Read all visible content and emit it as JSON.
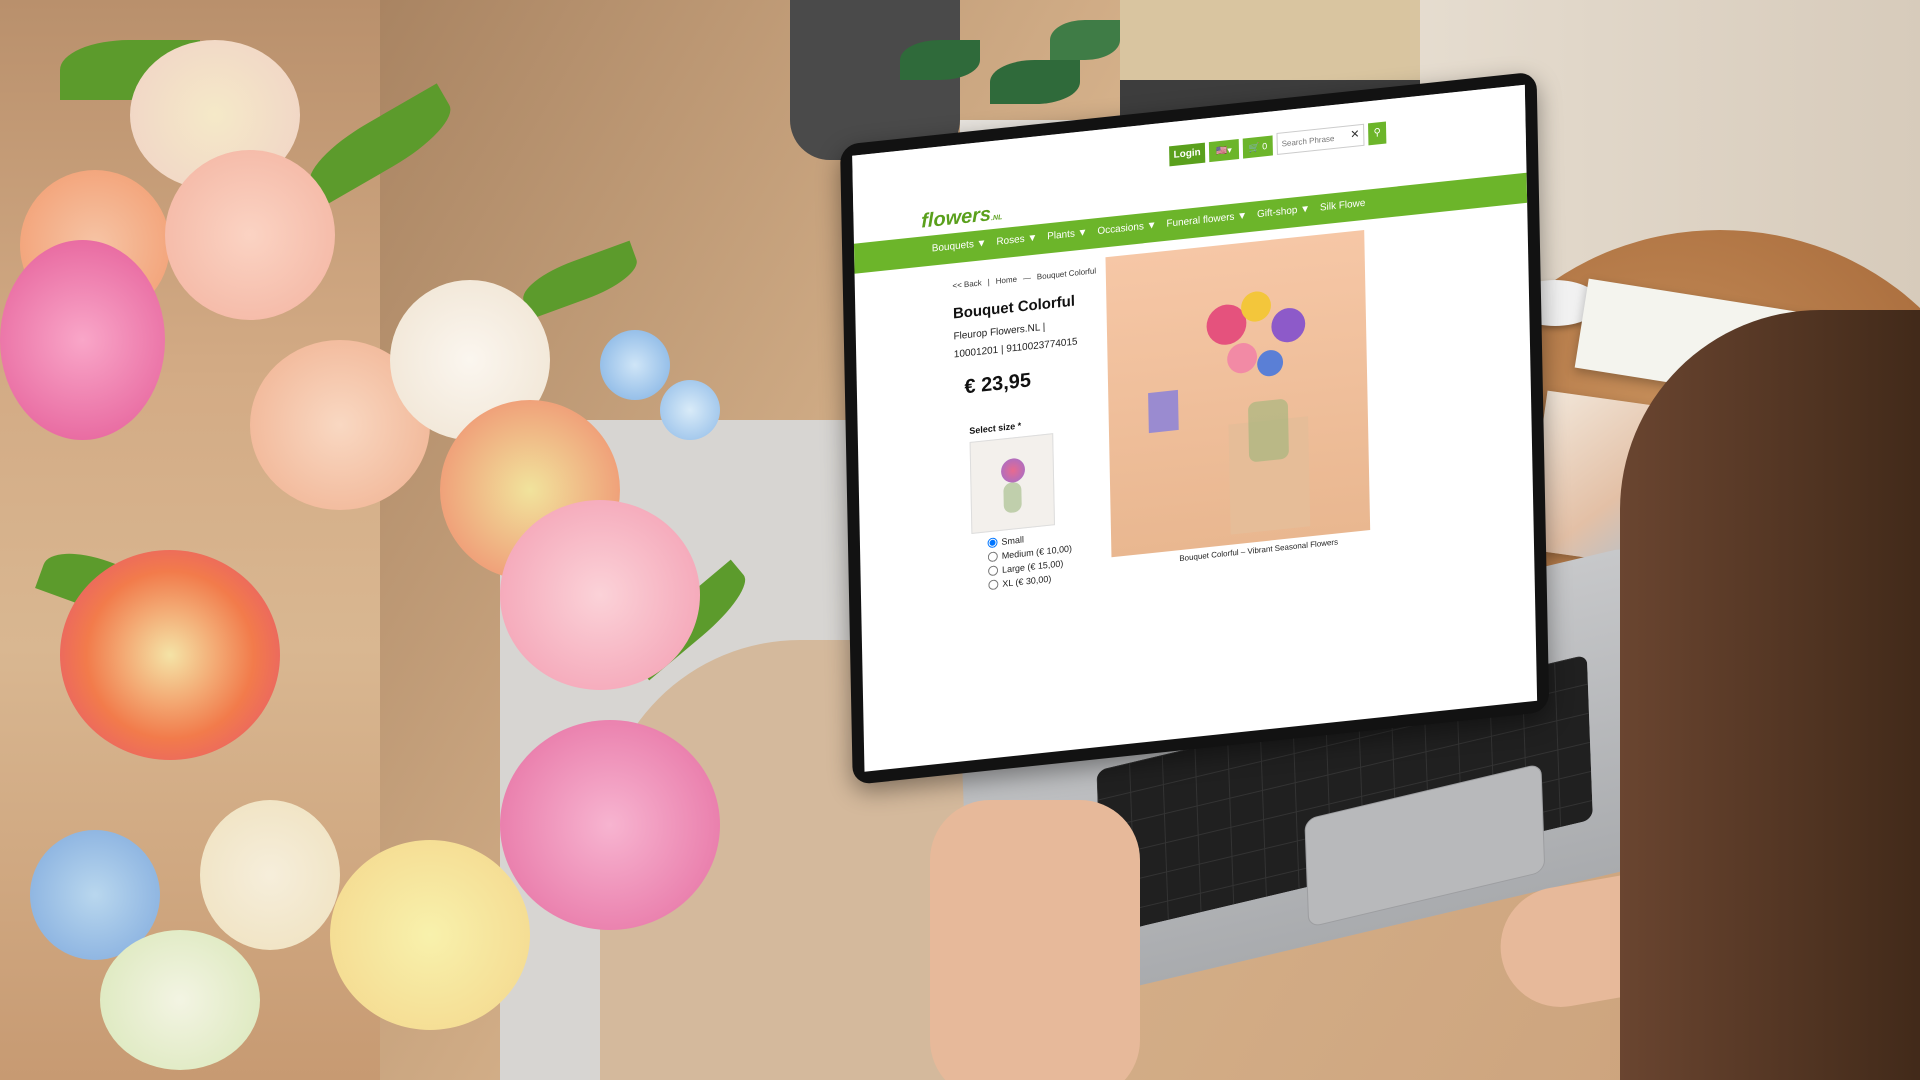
{
  "site": {
    "logo": "flowers",
    "logo_suffix": ".NL",
    "login_label": "Login",
    "cart_count": "0",
    "search_placeholder": "Search Phrase",
    "clear_icon": "✕",
    "search_icon": "⚲",
    "nav_items": [
      "Bouquets ▼",
      "Roses ▼",
      "Plants ▼",
      "Occasions ▼",
      "Funeral flowers ▼",
      "Gift-shop ▼",
      "Silk Flowe"
    ],
    "breadcrumb": [
      "<< Back",
      "|",
      "Home",
      "—",
      "Bouquet Colorful"
    ]
  },
  "product": {
    "title": "Bouquet Colorful",
    "brand": "Fleurop Flowers.NL  |",
    "codes": "10001201  |  9110023774015",
    "price": "€ 23,95",
    "select_size_label": "Select size *",
    "options": [
      "Small",
      "Medium (€ 10,00)",
      "Large (€ 15,00)",
      "XL (€ 30,00)"
    ],
    "selected_option": "Small",
    "caption": "Bouquet Colorful – Vibrant Seasonal Flowers"
  },
  "colors": {
    "brand_green": "#6cb52a",
    "brand_green_dark": "#5aa01c"
  }
}
